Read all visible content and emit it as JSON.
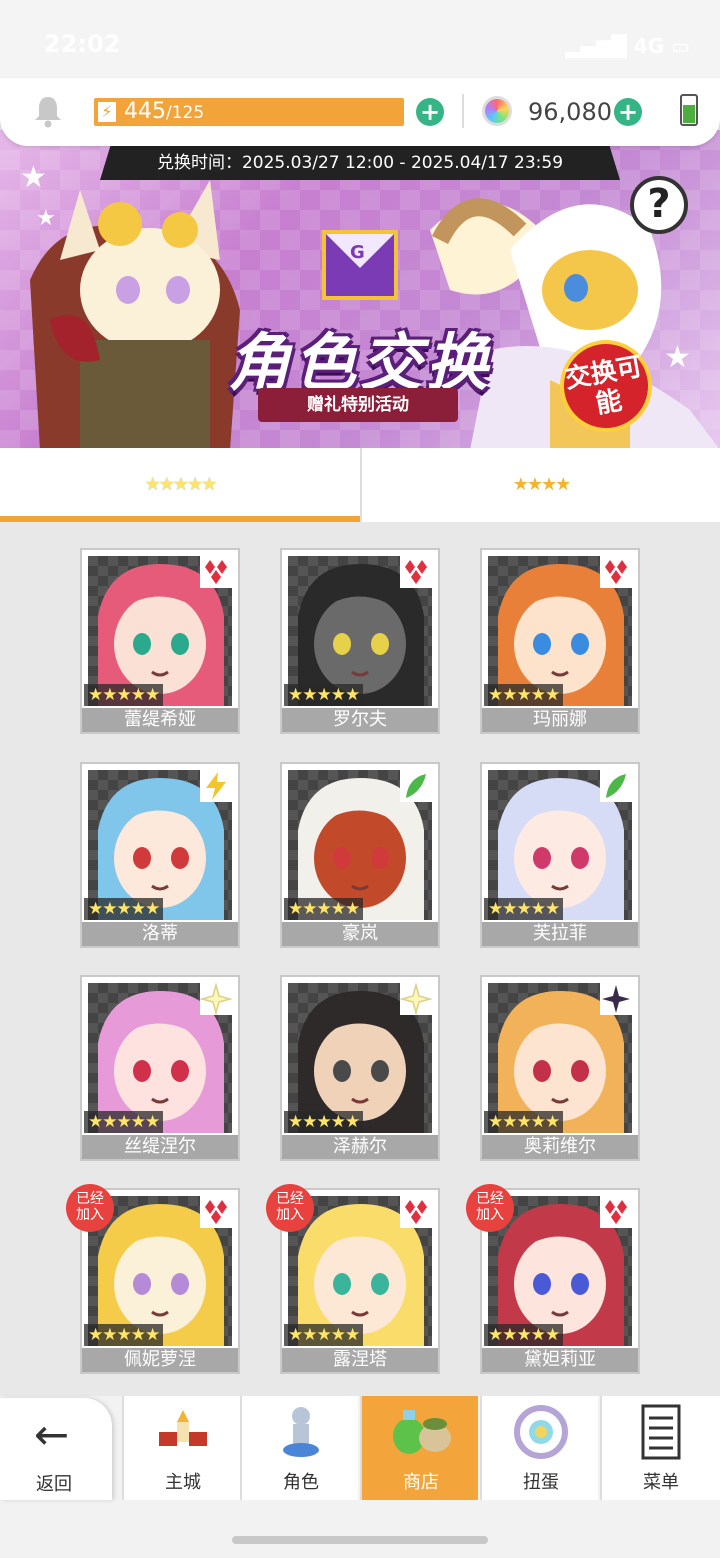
{
  "status": {
    "time": "22:02",
    "network": "4G"
  },
  "resources": {
    "energy_current": "445",
    "energy_max": "/125",
    "gems": "96,080"
  },
  "banner": {
    "exchange_period": "兑换时间：2025.03/27 12:00 - 2025.04/17 23:59",
    "title": "角色交换",
    "subtitle": "赠礼特别活动",
    "badge": "交换可能",
    "envelope_letter": "G"
  },
  "tabs": [
    {
      "label": "★★★★★"
    },
    {
      "label": "★★★★"
    }
  ],
  "characters": [
    {
      "name": "蕾缇希娅",
      "stars": "★★★★★",
      "element": "diamond",
      "joined": false
    },
    {
      "name": "罗尔夫",
      "stars": "★★★★★",
      "element": "diamond",
      "joined": false
    },
    {
      "name": "玛丽娜",
      "stars": "★★★★★",
      "element": "diamond",
      "joined": false
    },
    {
      "name": "洛蒂",
      "stars": "★★★★★",
      "element": "lightning",
      "joined": false
    },
    {
      "name": "豪岚",
      "stars": "★★★★★",
      "element": "leaf",
      "joined": false
    },
    {
      "name": "芙拉菲",
      "stars": "★★★★★",
      "element": "leaf",
      "joined": false
    },
    {
      "name": "丝缇涅尔",
      "stars": "★★★★★",
      "element": "light",
      "joined": false
    },
    {
      "name": "泽赫尔",
      "stars": "★★★★★",
      "element": "light",
      "joined": false
    },
    {
      "name": "奥莉维尔",
      "stars": "★★★★★",
      "element": "dark",
      "joined": false
    },
    {
      "name": "佩妮萝涅",
      "stars": "★★★★★",
      "element": "diamond",
      "joined": true
    },
    {
      "name": "露涅塔",
      "stars": "★★★★★",
      "element": "diamond",
      "joined": true
    },
    {
      "name": "黛妲莉亚",
      "stars": "★★★★★",
      "element": "diamond",
      "joined": true
    }
  ],
  "joined_label": "已经\n加入",
  "nav": {
    "back": "返回",
    "items": [
      {
        "label": "主城",
        "icon": "castle-icon"
      },
      {
        "label": "角色",
        "icon": "character-icon"
      },
      {
        "label": "商店",
        "icon": "shop-icon"
      },
      {
        "label": "扭蛋",
        "icon": "gacha-icon"
      },
      {
        "label": "菜单",
        "icon": "menu-icon"
      }
    ]
  },
  "colors": {
    "accent": "#f2a33a",
    "green": "#35b585",
    "red": "#e8423f"
  }
}
